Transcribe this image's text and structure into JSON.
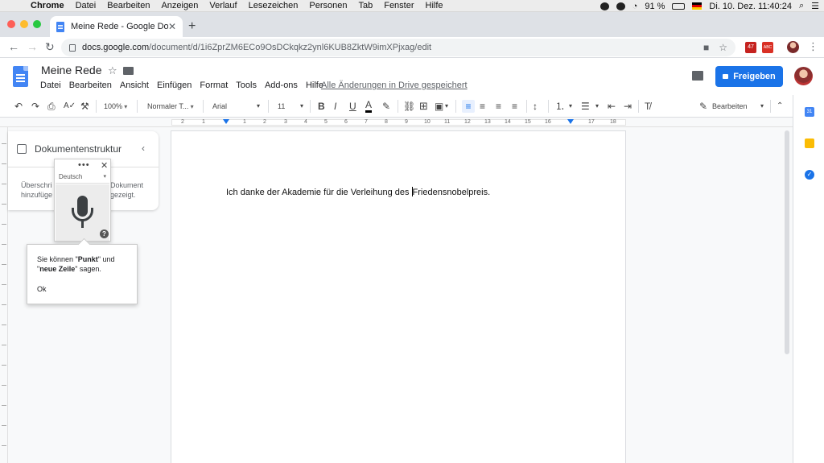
{
  "macos": {
    "apple_icon": "apple-icon",
    "menus": [
      "Chrome",
      "Datei",
      "Bearbeiten",
      "Anzeigen",
      "Verlauf",
      "Lesezeichen",
      "Personen",
      "Tab",
      "Fenster",
      "Hilfe"
    ],
    "battery": "91 %",
    "clock": "Di. 10. Dez.  11:40:24"
  },
  "browser": {
    "tab_title": "Meine Rede - Google Docs",
    "url_host": "docs.google.com",
    "url_path": "/document/d/1i6ZprZM6ECo9OsDCkqkz2ynl6KUB8ZktW9imXPjxag/edit",
    "ext_badge": "47",
    "ext_badge2": "ABC"
  },
  "docs": {
    "title": "Meine Rede",
    "menu": [
      "Datei",
      "Bearbeiten",
      "Ansicht",
      "Einfügen",
      "Format",
      "Tools",
      "Add-ons",
      "Hilfe"
    ],
    "saved_status": "Alle Änderungen in Drive gespeichert",
    "share_label": "Freigeben"
  },
  "toolbar": {
    "zoom": "100%",
    "style": "Normaler T...",
    "font": "Arial",
    "size": "11",
    "mode": "Bearbeiten"
  },
  "ruler": {
    "numbers": [
      "2",
      "1",
      "1",
      "2",
      "3",
      "4",
      "5",
      "6",
      "7",
      "8",
      "9",
      "10",
      "11",
      "12",
      "13",
      "14",
      "15",
      "16",
      "17",
      "18"
    ]
  },
  "outline": {
    "title": "Dokumentenstruktur",
    "line1": "Überschri",
    "line2": "hinzufüge",
    "line3": "Dokument",
    "line4": "gezeigt."
  },
  "voice": {
    "language": "Deutsch",
    "more": "•••",
    "close": "✕",
    "help": "?"
  },
  "tip": {
    "l1_a": "Sie können \"",
    "l1_b": "Punkt",
    "l1_c": "\" und",
    "l2_a": "\"",
    "l2_b": "neue Zeile",
    "l2_c": "\" sagen.",
    "ok": "Ok"
  },
  "document": {
    "text_before_cursor": "Ich danke der Akademie für die Verleihung des ",
    "text_after_cursor": "Friedensnobelpreis."
  },
  "colors": {
    "accent": "#1a73e8",
    "docs_blue": "#4285f4"
  }
}
